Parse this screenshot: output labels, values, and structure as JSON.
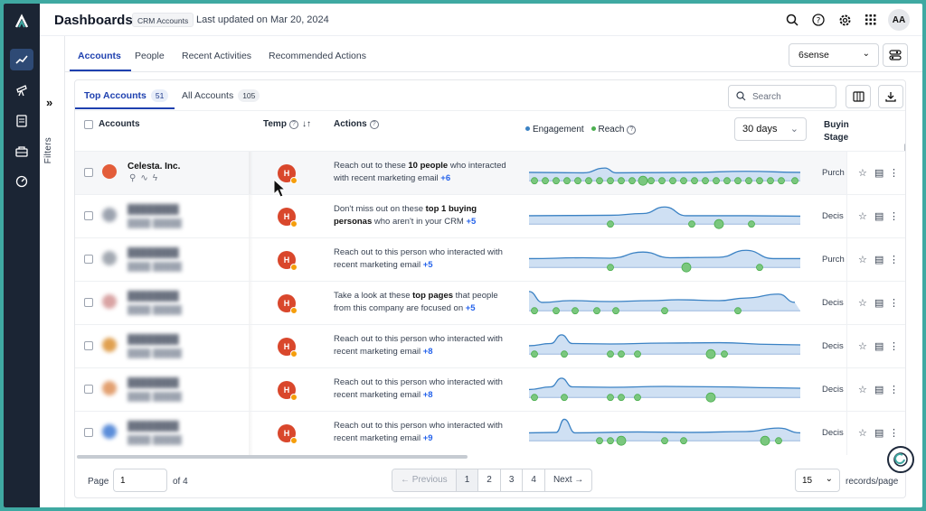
{
  "header": {
    "title": "Dashboards",
    "badge": "CRM Accounts",
    "updated": "Last updated on Mar 20, 2024",
    "avatar": "AA",
    "icons": [
      "search-icon",
      "help-icon",
      "settings-icon",
      "apps-grid-icon"
    ]
  },
  "rail": {
    "icons": [
      "logo-icon",
      "trending-icon",
      "telescope-icon",
      "document-icon",
      "inbox-icon",
      "gauge-icon"
    ]
  },
  "filters": {
    "label": "Filters"
  },
  "tabs": [
    "Accounts",
    "People",
    "Recent Activities",
    "Recommended Actions"
  ],
  "source_select": "6sense",
  "subtabs": [
    {
      "label": "Top Accounts",
      "count": "51"
    },
    {
      "label": "All Accounts",
      "count": "105"
    }
  ],
  "search_placeholder": "Search",
  "columns": {
    "accounts": "Accounts",
    "temp": "Temp",
    "actions": "Actions",
    "engagement": "Engagement",
    "reach": "Reach",
    "buying_stage_1": "Buyin",
    "buying_stage_2": "Stage",
    "days": "30 days"
  },
  "colors": {
    "engagement": "#3b82c4",
    "reach": "#4caf50",
    "accent": "#1e40af",
    "temp": "#d9472c"
  },
  "rows": [
    {
      "name": "Celesta. Inc.",
      "temp": "H",
      "action_pre": "Reach out to these ",
      "action_bold": "10 people",
      "action_post": " who interacted with recent marketing email ",
      "more": "+6",
      "stage": "Purch"
    },
    {
      "name": "",
      "temp": "H",
      "action_pre": "Don't miss out on these ",
      "action_bold": "top 1 buying personas",
      "action_post": " who aren't in your CRM ",
      "more": "+5",
      "stage": "Decis"
    },
    {
      "name": "",
      "temp": "H",
      "action_pre": "Reach out to this person who interacted with recent marketing email ",
      "action_bold": "",
      "action_post": "",
      "more": "+5",
      "stage": "Purch"
    },
    {
      "name": "",
      "temp": "H",
      "action_pre": "Take a look at these ",
      "action_bold": "top pages",
      "action_post": " that people from this company are focused on ",
      "more": "+5",
      "stage": "Decis"
    },
    {
      "name": "",
      "temp": "H",
      "action_pre": "Reach out to this person who interacted with recent marketing email ",
      "action_bold": "",
      "action_post": "",
      "more": "+8",
      "stage": "Decis"
    },
    {
      "name": "",
      "temp": "H",
      "action_pre": "Reach out to this person who interacted with recent marketing email ",
      "action_bold": "",
      "action_post": "",
      "more": "+8",
      "stage": "Decis"
    },
    {
      "name": "",
      "temp": "H",
      "action_pre": "Reach out to this person who interacted with recent marketing email ",
      "action_bold": "",
      "action_post": "",
      "more": "+9",
      "stage": "Decis"
    }
  ],
  "footer": {
    "page_label": "Page",
    "page_value": "1",
    "of_label": "of 4",
    "prev": "← Previous",
    "pages": [
      "1",
      "2",
      "3",
      "4"
    ],
    "next": "Next →",
    "per_page": "15",
    "per_page_label": "records/page"
  }
}
